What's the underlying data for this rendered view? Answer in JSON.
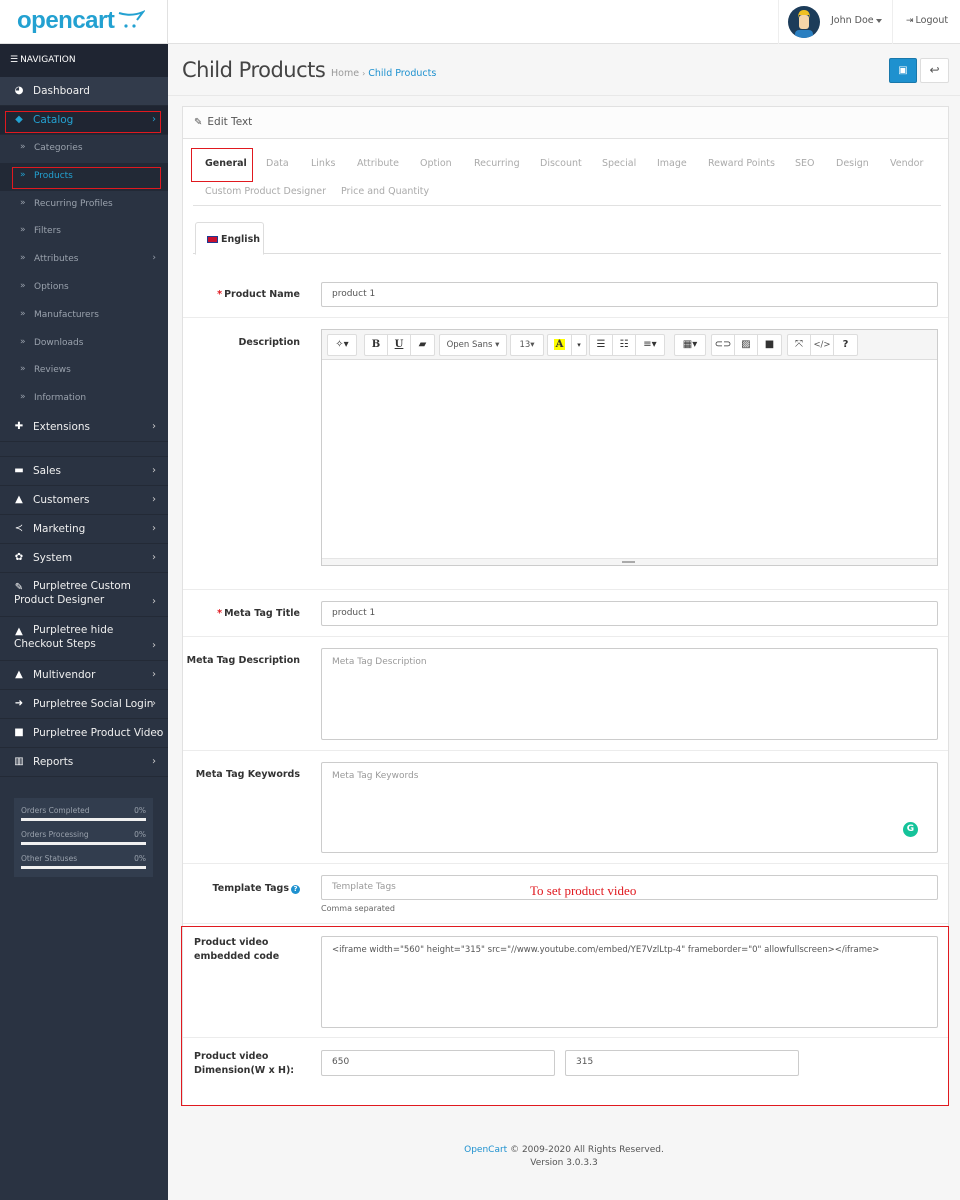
{
  "header": {
    "logo_text": "opencart",
    "user_name": "John Doe",
    "logout_label": "Logout"
  },
  "sidebar": {
    "nav_heading": "NAVIGATION",
    "items": [
      {
        "label": "Dashboard",
        "icon": "dashboard-icon"
      },
      {
        "label": "Catalog",
        "icon": "tag-icon"
      },
      {
        "label": "Extensions",
        "icon": "puzzle-icon"
      },
      {
        "label": "Sales",
        "icon": "cart-icon"
      },
      {
        "label": "Customers",
        "icon": "user-icon"
      },
      {
        "label": "Marketing",
        "icon": "share-icon"
      },
      {
        "label": "System",
        "icon": "gear-icon"
      },
      {
        "label": "Purpletree Custom Product Designer",
        "icon": "brush-icon"
      },
      {
        "label": "Purpletree hide Checkout Steps",
        "icon": "user-icon"
      },
      {
        "label": "Multivendor",
        "icon": "user-icon"
      },
      {
        "label": "Purpletree Social Login",
        "icon": "sign-in-icon"
      },
      {
        "label": "Purpletree Product Video",
        "icon": "video-icon"
      },
      {
        "label": "Reports",
        "icon": "bar-chart-icon"
      }
    ],
    "catalog_sub": [
      {
        "label": "Categories"
      },
      {
        "label": "Products"
      },
      {
        "label": "Recurring Profiles"
      },
      {
        "label": "Filters"
      },
      {
        "label": "Attributes"
      },
      {
        "label": "Options"
      },
      {
        "label": "Manufacturers"
      },
      {
        "label": "Downloads"
      },
      {
        "label": "Reviews"
      },
      {
        "label": "Information"
      }
    ],
    "stats": [
      {
        "label": "Orders Completed",
        "value": "0%",
        "percent": 0
      },
      {
        "label": "Orders Processing",
        "value": "0%",
        "percent": 0
      },
      {
        "label": "Other Statuses",
        "value": "0%",
        "percent": 0
      }
    ]
  },
  "page": {
    "title": "Child Products",
    "breadcrumb": [
      "Home",
      "Child Products"
    ],
    "save_icon": "save-icon",
    "back_icon": "reply-icon"
  },
  "panel": {
    "heading": "Edit Text",
    "tabs": [
      "General",
      "Data",
      "Links",
      "Attribute",
      "Option",
      "Recurring",
      "Discount",
      "Special",
      "Image",
      "Reward Points",
      "SEO",
      "Design",
      "Vendor",
      "Custom Product Designer",
      "Price and Quantity"
    ],
    "language_tab": "English"
  },
  "form": {
    "product_name": {
      "label": "Product Name",
      "value": "product 1"
    },
    "description": {
      "label": "Description"
    },
    "editor": {
      "font": "Open Sans",
      "size": "13",
      "color_letter": "A"
    },
    "meta_title": {
      "label": "Meta Tag Title",
      "value": "product 1"
    },
    "meta_description": {
      "label": "Meta Tag Description",
      "placeholder": "Meta Tag Description"
    },
    "meta_keywords": {
      "label": "Meta Tag Keywords",
      "placeholder": "Meta Tag Keywords"
    },
    "tags": {
      "label": "Template Tags",
      "placeholder": "Template Tags",
      "help": "Comma separated"
    },
    "video_code": {
      "label": "Product video embedded code",
      "value": "<iframe width=\"560\" height=\"315\" src=\"//www.youtube.com/embed/YE7VzlLtp-4\" frameborder=\"0\" allowfullscreen></iframe>"
    },
    "video_dimension": {
      "label": "Product video Dimension(W x H):",
      "width": "650",
      "height": "315"
    }
  },
  "annotation": "To set product video",
  "footer": {
    "brand": "OpenCart",
    "copyright": "© 2009-2020 All Rights Reserved.",
    "version": "Version 3.0.3.3"
  }
}
